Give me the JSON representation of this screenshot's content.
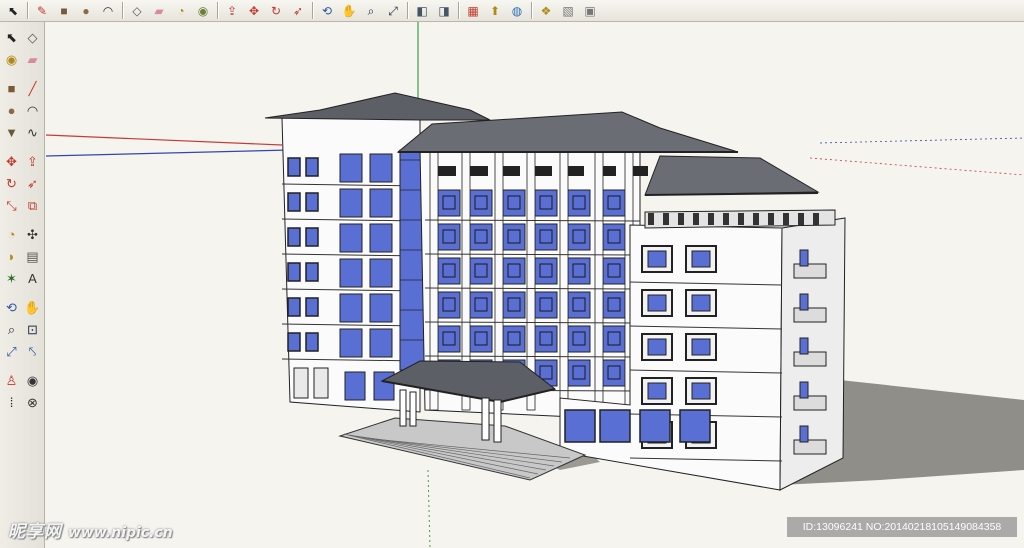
{
  "toolbar": {
    "items": [
      {
        "name": "select-icon",
        "glyph": "⬉",
        "color": "#222"
      },
      {
        "sep": true
      },
      {
        "name": "pencil-icon",
        "glyph": "✎",
        "color": "#c0392b"
      },
      {
        "name": "rectangle-icon",
        "glyph": "■",
        "color": "#7a5a36"
      },
      {
        "name": "circle-icon",
        "glyph": "●",
        "color": "#8b6a44"
      },
      {
        "name": "arc-icon",
        "glyph": "◠",
        "color": "#333"
      },
      {
        "sep": true
      },
      {
        "name": "make-component-icon",
        "glyph": "◇",
        "color": "#555"
      },
      {
        "name": "eraser-icon",
        "glyph": "▰",
        "color": "#d98aa0"
      },
      {
        "name": "tape-measure-icon",
        "glyph": "◔",
        "color": "#b28a17"
      },
      {
        "name": "paint-bucket-icon",
        "glyph": "◉",
        "color": "#6a7f3a"
      },
      {
        "sep": true
      },
      {
        "name": "push-pull-icon",
        "glyph": "⇪",
        "color": "#b33"
      },
      {
        "name": "move-icon",
        "glyph": "✥",
        "color": "#c0392b"
      },
      {
        "name": "rotate-icon",
        "glyph": "↻",
        "color": "#c0392b"
      },
      {
        "name": "follow-me-icon",
        "glyph": "➶",
        "color": "#c0392b"
      },
      {
        "sep": true
      },
      {
        "name": "orbit-icon",
        "glyph": "⟲",
        "color": "#2c5aa0"
      },
      {
        "name": "pan-icon",
        "glyph": "✋",
        "color": "#777"
      },
      {
        "name": "zoom-icon",
        "glyph": "⌕",
        "color": "#234"
      },
      {
        "name": "zoom-extents-icon",
        "glyph": "⤢",
        "color": "#234"
      },
      {
        "sep": true
      },
      {
        "name": "previous-view-icon",
        "glyph": "◧",
        "color": "#456"
      },
      {
        "name": "next-view-icon",
        "glyph": "◨",
        "color": "#456"
      },
      {
        "sep": true
      },
      {
        "name": "get-models-icon",
        "glyph": "▦",
        "color": "#c0392b"
      },
      {
        "name": "share-model-icon",
        "glyph": "⬆",
        "color": "#b28a17"
      },
      {
        "name": "google-earth-icon",
        "glyph": "◍",
        "color": "#2c6fb3"
      },
      {
        "sep": true
      },
      {
        "name": "components-icon",
        "glyph": "❖",
        "color": "#b28a17"
      },
      {
        "name": "materials-icon",
        "glyph": "▧",
        "color": "#777"
      },
      {
        "name": "styles-icon",
        "glyph": "▣",
        "color": "#777"
      }
    ]
  },
  "palette": {
    "rows": [
      [
        {
          "name": "select-tool-icon",
          "glyph": "⬉",
          "color": "#222"
        },
        {
          "name": "make-component-tool-icon",
          "glyph": "◇",
          "color": "#555"
        }
      ],
      [
        {
          "name": "paint-bucket-tool-icon",
          "glyph": "◉",
          "color": "#b28a17"
        },
        {
          "name": "eraser-tool-icon",
          "glyph": "▰",
          "color": "#d98aa0"
        }
      ],
      {
        "gap": true
      },
      [
        {
          "name": "rectangle-tool-icon",
          "glyph": "■",
          "color": "#7a5a36"
        },
        {
          "name": "line-tool-icon",
          "glyph": "╱",
          "color": "#c0392b"
        }
      ],
      [
        {
          "name": "circle-tool-icon",
          "glyph": "●",
          "color": "#8b6a44"
        },
        {
          "name": "arc-tool-icon",
          "glyph": "◠",
          "color": "#333"
        }
      ],
      [
        {
          "name": "polygon-tool-icon",
          "glyph": "▼",
          "color": "#6b5a3a"
        },
        {
          "name": "freehand-tool-icon",
          "glyph": "∿",
          "color": "#333"
        }
      ],
      {
        "gap": true
      },
      [
        {
          "name": "move-tool-icon",
          "glyph": "✥",
          "color": "#c0392b"
        },
        {
          "name": "push-pull-tool-icon",
          "glyph": "⇪",
          "color": "#c0392b"
        }
      ],
      [
        {
          "name": "rotate-tool-icon",
          "glyph": "↻",
          "color": "#c0392b"
        },
        {
          "name": "follow-me-tool-icon",
          "glyph": "➶",
          "color": "#c0392b"
        }
      ],
      [
        {
          "name": "scale-tool-icon",
          "glyph": "⤡",
          "color": "#c0392b"
        },
        {
          "name": "offset-tool-icon",
          "glyph": "⧉",
          "color": "#c0392b"
        }
      ],
      {
        "gap": true
      },
      [
        {
          "name": "tape-measure-tool-icon",
          "glyph": "◔",
          "color": "#b28a17"
        },
        {
          "name": "dimension-tool-icon",
          "glyph": "✣",
          "color": "#333"
        }
      ],
      [
        {
          "name": "protractor-tool-icon",
          "glyph": "◗",
          "color": "#b28a17"
        },
        {
          "name": "text-tool-icon",
          "glyph": "▤",
          "color": "#555"
        }
      ],
      [
        {
          "name": "axes-tool-icon",
          "glyph": "✶",
          "color": "#2a6e2a"
        },
        {
          "name": "3d-text-tool-icon",
          "glyph": "A",
          "color": "#333"
        }
      ],
      {
        "gap": true
      },
      [
        {
          "name": "orbit-tool-icon",
          "glyph": "⟲",
          "color": "#2c5aa0"
        },
        {
          "name": "pan-tool-icon",
          "glyph": "✋",
          "color": "#777"
        }
      ],
      [
        {
          "name": "zoom-tool-icon",
          "glyph": "⌕",
          "color": "#234"
        },
        {
          "name": "zoom-window-tool-icon",
          "glyph": "⊡",
          "color": "#234"
        }
      ],
      [
        {
          "name": "zoom-extents-tool-icon",
          "glyph": "⤢",
          "color": "#2c5aa0"
        },
        {
          "name": "previous-tool-icon",
          "glyph": "⤣",
          "color": "#2c5aa0"
        }
      ],
      {
        "gap": true
      },
      [
        {
          "name": "position-camera-tool-icon",
          "glyph": "♙",
          "color": "#c0392b"
        },
        {
          "name": "look-around-tool-icon",
          "glyph": "◉",
          "color": "#333"
        }
      ],
      [
        {
          "name": "walk-tool-icon",
          "glyph": "⁞",
          "color": "#222"
        },
        {
          "name": "section-plane-tool-icon",
          "glyph": "⊗",
          "color": "#333"
        }
      ]
    ]
  },
  "viewport": {
    "background": "#f5f4ef",
    "axis_colors": {
      "red": "#c63a3a",
      "green": "#3aa14a",
      "blue": "#3546a8"
    },
    "glass_color": "#5a6fd4",
    "roof_color": "#5c5f66",
    "shadow_color": "#8f8e89"
  },
  "watermark": {
    "site_name": "昵享网",
    "site_url": "www.nipic.cn",
    "image_id": "ID:13096241 NO:20140218105149084358"
  }
}
